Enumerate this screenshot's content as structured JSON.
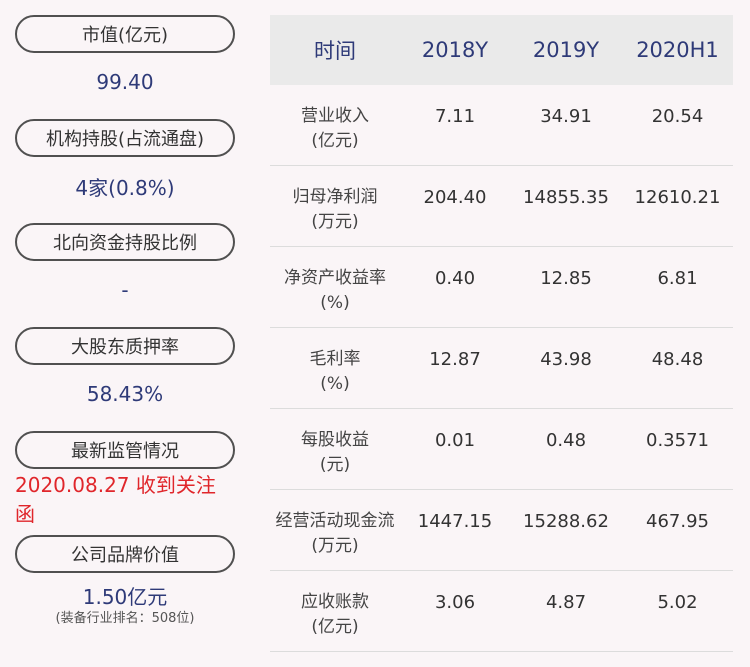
{
  "left": [
    {
      "label": "市值(亿元)",
      "value": "99.40",
      "alert": false
    },
    {
      "label": "机构持股(占流通盘)",
      "value": "4家(0.8%)",
      "alert": false
    },
    {
      "label": "北向资金持股比例",
      "value": "-",
      "alert": false
    },
    {
      "label": "大股东质押率",
      "value": "58.43%",
      "alert": false
    },
    {
      "label": "最新监管情况",
      "value": "2020.08.27 收到关注函",
      "alert": true
    },
    {
      "label": "公司品牌价值",
      "value": "1.50亿元",
      "sub": "(装备行业排名：508位)",
      "alert": false
    }
  ],
  "table": {
    "headers": [
      "时间",
      "2018Y",
      "2019Y",
      "2020H1"
    ],
    "rows": [
      {
        "name": "营业收入",
        "unit": "(亿元)",
        "values": [
          "7.11",
          "34.91",
          "20.54"
        ]
      },
      {
        "name": "归母净利润",
        "unit": "(万元)",
        "values": [
          "204.40",
          "14855.35",
          "12610.21"
        ]
      },
      {
        "name": "净资产收益率",
        "unit": "(%)",
        "values": [
          "0.40",
          "12.85",
          "6.81"
        ]
      },
      {
        "name": "毛利率",
        "unit": "(%)",
        "values": [
          "12.87",
          "43.98",
          "48.48"
        ]
      },
      {
        "name": "每股收益",
        "unit": "(元)",
        "values": [
          "0.01",
          "0.48",
          "0.3571"
        ]
      },
      {
        "name": "经营活动现金流",
        "unit": "(万元)",
        "values": [
          "1447.15",
          "15288.62",
          "467.95"
        ]
      },
      {
        "name": "应收账款",
        "unit": "(亿元)",
        "values": [
          "3.06",
          "4.87",
          "5.02"
        ]
      }
    ]
  },
  "colors": {
    "background": "#faf5f7",
    "value_text": "#2e3a78",
    "alert_text": "#e0262b",
    "header_bg": "#eaeaea"
  }
}
